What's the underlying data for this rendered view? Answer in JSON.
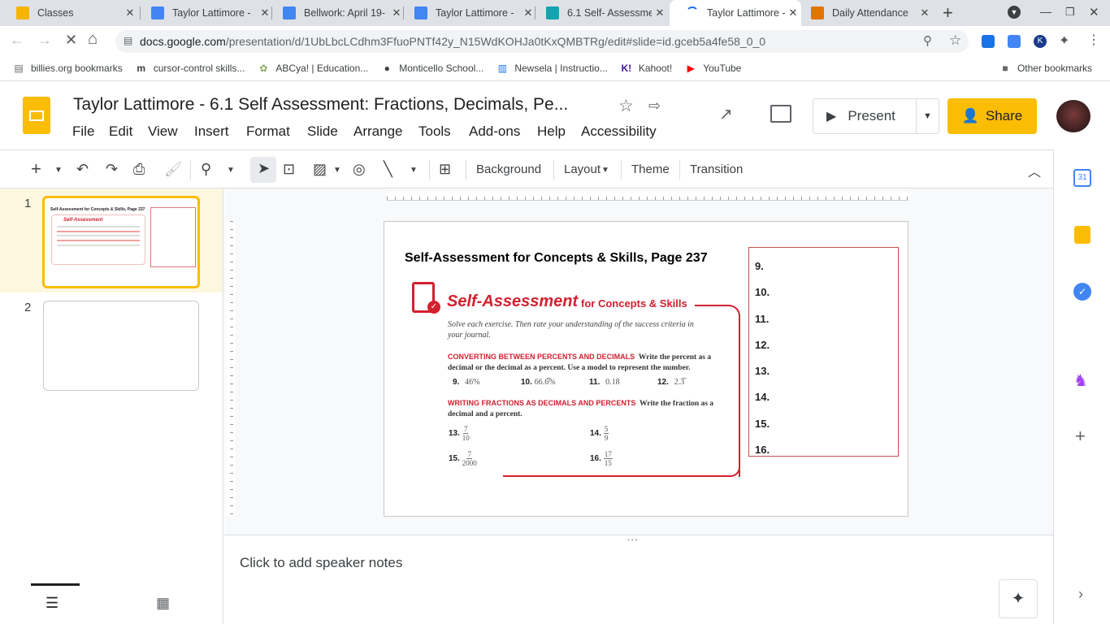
{
  "browser": {
    "tabs": [
      {
        "title": "Classes",
        "color": "#f4b400"
      },
      {
        "title": "Taylor Lattimore -",
        "color": "#4285f4"
      },
      {
        "title": "Bellwork: April 19-",
        "color": "#4285f4"
      },
      {
        "title": "Taylor Lattimore -",
        "color": "#4285f4"
      },
      {
        "title": "6.1 Self- Assessme",
        "color": "#12a4af"
      },
      {
        "title": "Taylor Lattimore -",
        "color": "#4285f4"
      },
      {
        "title": "Daily Attendance",
        "color": "#e37400"
      }
    ],
    "url_host": "docs.google.com",
    "url_path": "/presentation/d/1UbLbcLCdhm3FfuoPNTf42y_N15WdKOHJa0tKxQMBTRg/edit#slide=id.gceb5a4fe58_0_0",
    "bookmarks": [
      "billies.org bookmarks",
      "cursor-control skills...",
      "ABCya! | Education...",
      "Monticello School...",
      "Newsela | Instructio...",
      "Kahoot!",
      "YouTube"
    ],
    "other_bookmarks": "Other bookmarks"
  },
  "app": {
    "title": "Taylor Lattimore - 6.1 Self Assessment:  Fractions, Decimals, Pe...",
    "menus": [
      "File",
      "Edit",
      "View",
      "Insert",
      "Format",
      "Slide",
      "Arrange",
      "Tools",
      "Add-ons",
      "Help",
      "Accessibility"
    ],
    "present": "Present",
    "share": "Share",
    "toolbar": {
      "background": "Background",
      "layout": "Layout",
      "theme": "Theme",
      "transition": "Transition"
    },
    "brand_color": "#fbbc04"
  },
  "filmstrip": [
    {
      "num": "1"
    },
    {
      "num": "2"
    }
  ],
  "slide": {
    "title": "Self-Assessment for Concepts & Skills, Page 237",
    "image": {
      "heading": "Self-Assessment",
      "subheading": "for Concepts & Skills",
      "intro": "Solve each exercise. Then rate your understanding of the success criteria in your journal.",
      "section1_title": "CONVERTING BETWEEN PERCENTS AND DECIMALS",
      "section1_text": "Write the percent as a decimal or the decimal as a percent. Use a model to represent the number.",
      "section1_items": [
        {
          "n": "9.",
          "v": "46%"
        },
        {
          "n": "10.",
          "v": "66.6̅%"
        },
        {
          "n": "11.",
          "v": "0.18"
        },
        {
          "n": "12.",
          "v": "2.3̅"
        }
      ],
      "section2_title": "WRITING FRACTIONS AS DECIMALS AND PERCENTS",
      "section2_text": "Write the fraction as a decimal and a percent.",
      "section2_items": [
        {
          "n": "13.",
          "num": "7",
          "den": "10"
        },
        {
          "n": "14.",
          "num": "5",
          "den": "9"
        },
        {
          "n": "15.",
          "num": "7",
          "den": "2000"
        },
        {
          "n": "16.",
          "num": "17",
          "den": "15"
        }
      ]
    },
    "answers": [
      "9.",
      "10.",
      "11.",
      "12.",
      "13.",
      "14.",
      "15.",
      "16."
    ]
  },
  "notes": {
    "placeholder": "Click to add speaker notes"
  }
}
